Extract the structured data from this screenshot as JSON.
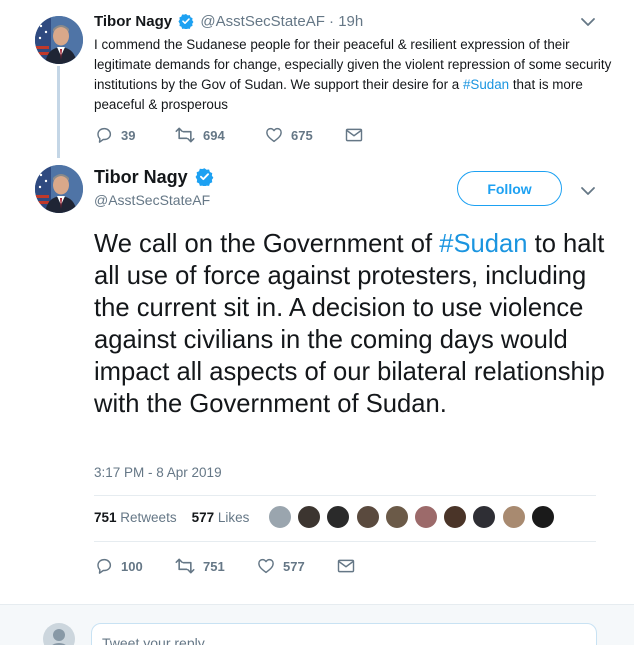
{
  "tweet_first": {
    "author_name": "Tibor Nagy",
    "author_handle": "@AsstSecStateAF",
    "separator": "·",
    "time": "19h",
    "text_before_hashtag": "I commend the Sudanese people for their peaceful & resilient expression of their legitimate demands for change, especially given the violent repression of some security institutions by the Gov of Sudan.  We support their desire for a ",
    "hashtag": "#Sudan",
    "text_after_hashtag": " that is more peaceful & prosperous",
    "replies": "39",
    "retweets": "694",
    "likes": "675"
  },
  "tweet_main": {
    "author_name": "Tibor Nagy",
    "author_handle": "@AsstSecStateAF",
    "follow_label": "Follow",
    "text_before_hashtag": "We call on the Government of ",
    "hashtag": "#Sudan",
    "text_after_hashtag": " to halt all use of force against protesters, including the current sit in.  A decision to use violence against civilians in the coming days would impact all aspects of our bilateral relationship with the Government of Sudan.",
    "timestamp": "3:17 PM - 8 Apr 2019",
    "retweet_count": "751",
    "retweet_label": "Retweets",
    "like_count": "577",
    "like_label": "Likes",
    "replies": "100",
    "retweets": "751",
    "likes": "577"
  },
  "reply": {
    "placeholder": "Tweet your reply"
  },
  "colors": {
    "accent": "#1da1f2",
    "hashtag": "#1b95e0",
    "muted": "#657786",
    "verified": "#1da1f2"
  },
  "likers_avatar_colors": [
    "#9aa5ae",
    "#3c3530",
    "#2a2a2a",
    "#5a4a3e",
    "#6b5a48",
    "#9c6a6a",
    "#4a3428",
    "#2e2e34",
    "#a88a70",
    "#1a1a1a"
  ]
}
